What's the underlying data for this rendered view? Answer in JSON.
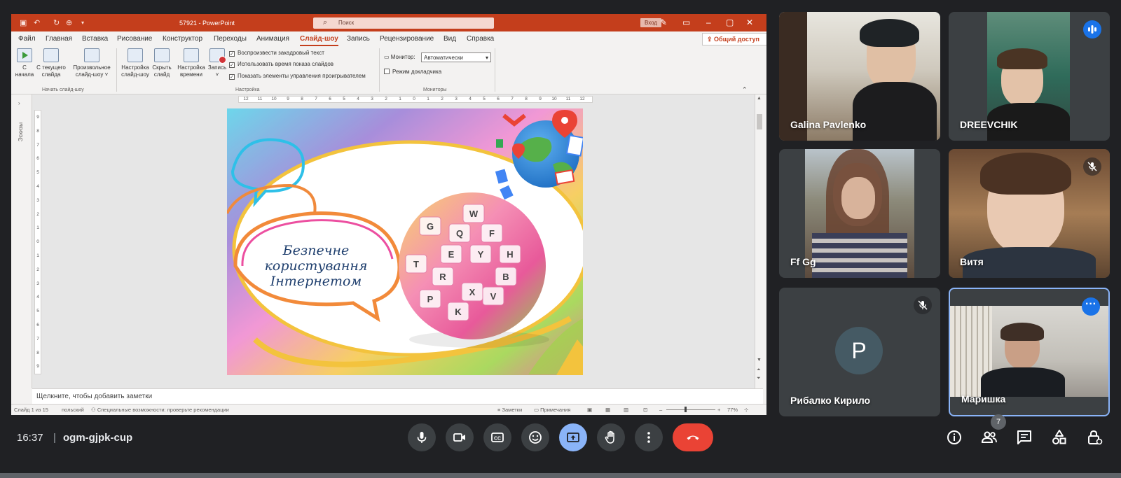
{
  "powerpoint": {
    "doc_title": "57921 - PowerPoint",
    "search_placeholder": "Поиск",
    "login_label": "Вход",
    "share_label": "Общий доступ",
    "tabs": [
      "Файл",
      "Главная",
      "Вставка",
      "Рисование",
      "Конструктор",
      "Переходы",
      "Анимация",
      "Слайд-шоу",
      "Запись",
      "Рецензирование",
      "Вид",
      "Справка"
    ],
    "active_tab": "Слайд-шоу",
    "ribbon": {
      "btn_from_start_1": "С",
      "btn_from_start_2": "начала",
      "btn_from_current_1": "С текущего",
      "btn_from_current_2": "слайда",
      "btn_custom_1": "Произвольное",
      "btn_custom_2": "слайд-шоу ˅",
      "group_start": "Начать слайд-шоу",
      "btn_setup_1": "Настройка",
      "btn_setup_2": "слайд-шоу",
      "btn_hide_1": "Скрыть",
      "btn_hide_2": "слайд",
      "btn_timing_1": "Настройка",
      "btn_timing_2": "времени",
      "btn_record_1": "Запись",
      "btn_record_2": "˅",
      "check_narration": "Воспроизвести закадровый текст",
      "check_timings": "Использовать время показа слайдов",
      "check_controls": "Показать элементы управления проигрывателем",
      "group_setup": "Настройка",
      "monitor_label": "Монитор:",
      "monitor_value": "Автоматически",
      "presenter_view": "Режим докладчика",
      "group_monitors": "Мониторы"
    },
    "thumbnails_label": "Эскизы",
    "slide": {
      "line1": "Безпечне",
      "line2": "користування",
      "line3": "Інтернетом",
      "key_letters": [
        "W",
        "Q",
        "F",
        "H",
        "G",
        "E",
        "Y",
        "B",
        "R",
        "X",
        "P",
        "V",
        "K",
        "T"
      ]
    },
    "ruler_marks": [
      "12",
      "11",
      "10",
      "9",
      "8",
      "7",
      "6",
      "5",
      "4",
      "3",
      "2",
      "1",
      "0",
      "1",
      "2",
      "3",
      "4",
      "5",
      "6",
      "7",
      "8",
      "9",
      "10",
      "11",
      "12"
    ],
    "ruler_v_marks": [
      "9",
      "8",
      "7",
      "6",
      "5",
      "4",
      "3",
      "2",
      "1",
      "0",
      "1",
      "2",
      "3",
      "4",
      "5",
      "6",
      "7",
      "8",
      "9"
    ],
    "notes_placeholder": "Щелкните, чтобы добавить заметки",
    "status": {
      "slide": "Слайд 1 из 15",
      "language": "польский",
      "accessibility": "Специальные возможности: проверьте рекомендации",
      "notes": "Заметки",
      "comments": "Примечания",
      "zoom": "77%"
    }
  },
  "participants": [
    {
      "name": "Galina Pavlenko"
    },
    {
      "name": "DREEVCHIK"
    },
    {
      "name": "Ff Gg"
    },
    {
      "name": "Витя"
    },
    {
      "name": "Рибалко Кирило",
      "initial": "P"
    },
    {
      "name": "Маришка"
    }
  ],
  "meeting": {
    "time": "16:37",
    "separator": "|",
    "code": "ogm-gjpk-cup",
    "participant_count": "7"
  },
  "colors": {
    "ppt_accent": "#c43e1c",
    "meet_bg": "#202124",
    "tile_bg": "#3c4043",
    "active_border": "#8ab4f8",
    "hangup": "#ea4335",
    "avatar_bg": "#455a64"
  }
}
